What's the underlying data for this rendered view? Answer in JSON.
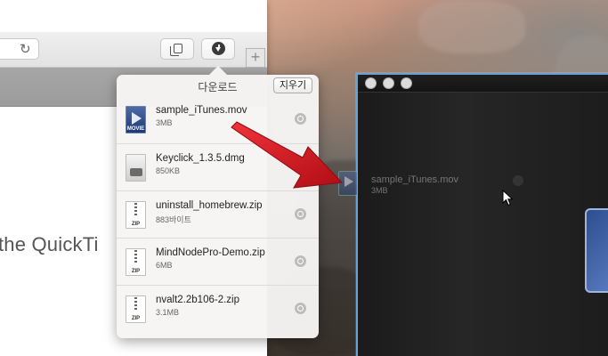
{
  "popover": {
    "title": "다운로드",
    "clear_label": "지우기"
  },
  "downloads": [
    {
      "name": "sample_iTunes.mov",
      "size": "3MB",
      "icon": "movie-file-icon",
      "tag": "MOVIE"
    },
    {
      "name": "Keyclick_1.3.5.dmg",
      "size": "850KB",
      "icon": "dmg-file-icon",
      "tag": ""
    },
    {
      "name": "uninstall_homebrew.zip",
      "size": "883바이트",
      "icon": "zip-file-icon",
      "tag": "ZIP"
    },
    {
      "name": "MindNodePro-Demo.zip",
      "size": "6MB",
      "icon": "zip-file-icon",
      "tag": "ZIP"
    },
    {
      "name": "nvalt2.2b106-2.zip",
      "size": "3.1MB",
      "icon": "zip-file-icon",
      "tag": "ZIP"
    }
  ],
  "drag_ghost": {
    "name": "sample_iTunes.mov",
    "size": "3MB",
    "tag": "MOVIE"
  },
  "page": {
    "partial_text": "the QuickTi"
  },
  "toolbar": {
    "new_tab_label": "+",
    "reload_label": "↻"
  },
  "colors": {
    "arrow": "#d8141c",
    "qt_border": "#6aa0d8"
  }
}
